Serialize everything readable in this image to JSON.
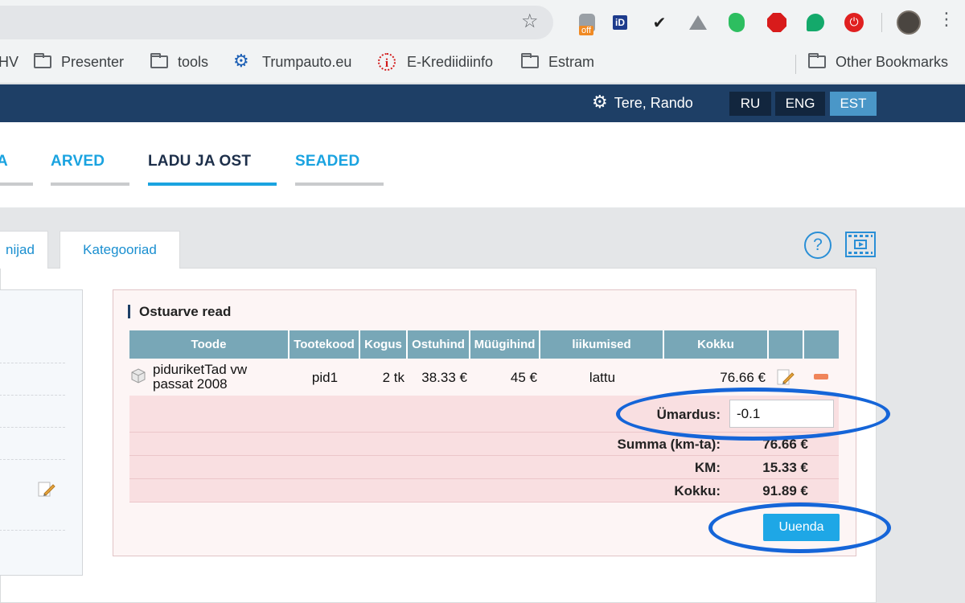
{
  "browser": {
    "bookmarks": [
      {
        "label": "HV",
        "icon": "folder-icon"
      },
      {
        "label": "Presenter",
        "icon": "folder-icon"
      },
      {
        "label": "tools",
        "icon": "folder-icon"
      },
      {
        "label": "Trumpauto.eu",
        "icon": "gear-icon"
      },
      {
        "label": "E-Krediidiinfo",
        "icon": "info-icon"
      },
      {
        "label": "Estram",
        "icon": "folder-icon"
      }
    ],
    "other_bookmarks": "Other Bookmarks",
    "extension_badge": "off",
    "extension_id_label": "iD"
  },
  "header": {
    "greeting": "Tere, Rando",
    "languages": [
      "RU",
      "ENG",
      "EST"
    ],
    "active_language": "EST",
    "colors": {
      "topbar": "#1e3f66",
      "accent": "#1aa3e0",
      "active_lang": "#4a97c8"
    }
  },
  "nav": {
    "tabs": [
      {
        "label": "A"
      },
      {
        "label": "ARVED"
      },
      {
        "label": "LADU JA OST",
        "active": true
      },
      {
        "label": "SEADED"
      }
    ]
  },
  "subtabs": [
    "nijad",
    "Kategooriad"
  ],
  "help": {
    "help_symbol": "?"
  },
  "section": {
    "title": "Ostuarve read",
    "columns": [
      "Toode",
      "Tootekood",
      "Kogus",
      "Ostuhind",
      "Müügihind",
      "liikumised",
      "Kokku",
      "",
      ""
    ],
    "rows": [
      {
        "product_line1": "piduriketTad vw",
        "product_line2": "passat 2008",
        "code": "pid1",
        "qty": "2 tk",
        "purchase_price": "38.33 €",
        "sale_price": "45 €",
        "movement": "lattu",
        "total": "76.66 €"
      }
    ],
    "rounding_label": "Ümardus:",
    "rounding_value": "-0.1",
    "sum_label": "Summa (km-ta):",
    "sum_value": "76.66 €",
    "vat_label": "KM:",
    "vat_value": "15.33 €",
    "total_label": "Kokku:",
    "total_value": "91.89 €",
    "update_button": "Uuenda"
  }
}
